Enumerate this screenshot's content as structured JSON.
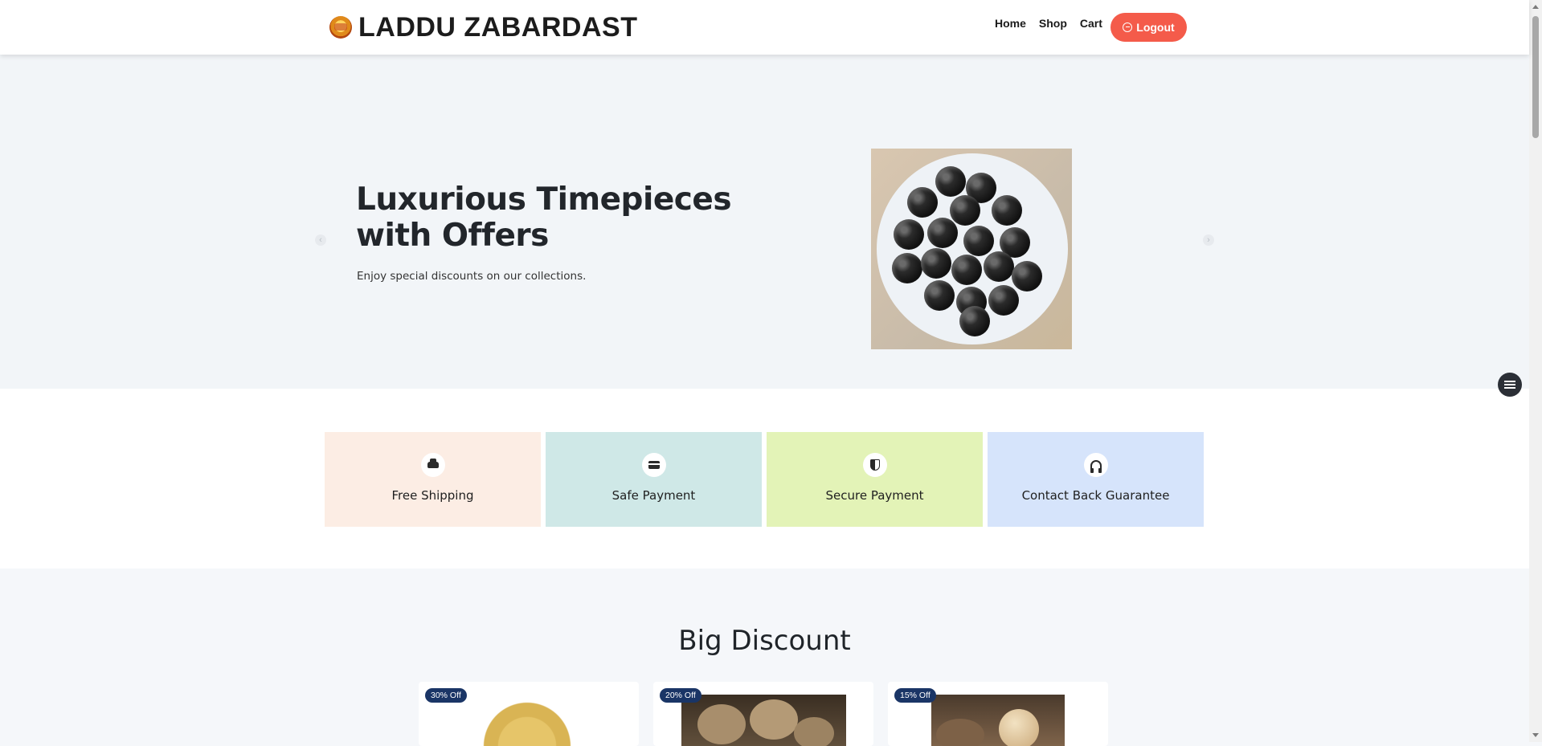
{
  "header": {
    "brand": "LADDU ZABARDAST",
    "nav": [
      "Home",
      "Shop",
      "Cart"
    ],
    "logout_label": "Logout"
  },
  "hero": {
    "title": "Luxurious Timepieces with Offers",
    "subtitle": "Enjoy special discounts on our collections.",
    "prev_icon": "chevron-left-icon",
    "next_icon": "chevron-right-icon"
  },
  "features": [
    {
      "label": "Free Shipping",
      "icon": "car-icon",
      "bg": "#fcede4"
    },
    {
      "label": "Safe Payment",
      "icon": "credit-card-icon",
      "bg": "#cfe8e7"
    },
    {
      "label": "Secure Payment",
      "icon": "shield-icon",
      "bg": "#e3f3b7"
    },
    {
      "label": "Contact Back Guarantee",
      "icon": "headset-icon",
      "bg": "#d6e4fb"
    }
  ],
  "discount": {
    "title": "Big Discount",
    "products": [
      {
        "badge": "30% Off"
      },
      {
        "badge": "20% Off"
      },
      {
        "badge": "15% Off"
      }
    ]
  },
  "colors": {
    "accent": "#f45b4a",
    "badge": "#1a3566"
  }
}
